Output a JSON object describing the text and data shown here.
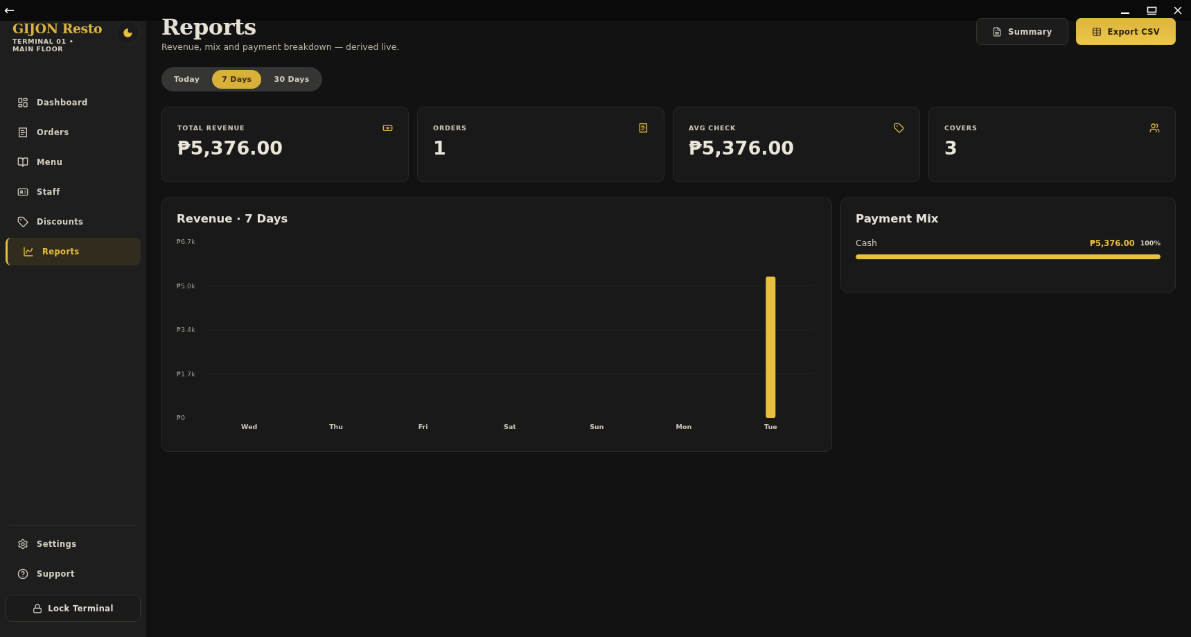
{
  "window": {
    "back": "←"
  },
  "sidebar": {
    "brand": "GIJON Resto",
    "terminal": "TERMINAL 01 • MAIN FLOOR",
    "items": [
      {
        "label": "Dashboard",
        "selected": false
      },
      {
        "label": "Orders",
        "selected": false
      },
      {
        "label": "Menu",
        "selected": false
      },
      {
        "label": "Staff",
        "selected": false
      },
      {
        "label": "Discounts",
        "selected": false
      },
      {
        "label": "Reports",
        "selected": true
      }
    ],
    "footer_items": [
      {
        "label": "Settings"
      },
      {
        "label": "Support"
      }
    ],
    "lock_button": "Lock Terminal"
  },
  "header": {
    "title": "Reports",
    "subtitle": "Revenue, mix and payment breakdown — derived live.",
    "buttons": [
      {
        "label": "Summary",
        "kind": "secondary"
      },
      {
        "label": "Export CSV",
        "kind": "primary"
      }
    ]
  },
  "range_tabs": [
    {
      "label": "Today",
      "selected": false
    },
    {
      "label": "7 Days",
      "selected": true
    },
    {
      "label": "30 Days",
      "selected": false
    }
  ],
  "stats": [
    {
      "label": "TOTAL REVENUE",
      "value": "₱5,376.00"
    },
    {
      "label": "ORDERS",
      "value": "1"
    },
    {
      "label": "AVG CHECK",
      "value": "₱5,376.00"
    },
    {
      "label": "COVERS",
      "value": "3"
    }
  ],
  "revenue_card": {
    "chart_data": {
      "type": "bar",
      "title": "Revenue · 7 Days",
      "categories": [
        "Wed",
        "Thu",
        "Fri",
        "Sat",
        "Sun",
        "Mon",
        "Tue"
      ],
      "series": [
        {
          "color": "#e8bf3e",
          "values": [
            0,
            0,
            0,
            0,
            0,
            0,
            5400
          ]
        }
      ],
      "ylim": [
        0,
        6720
      ],
      "yticks": [
        {
          "value": 0,
          "label": "₱0"
        },
        {
          "value": 1680,
          "label": "₱1.7k"
        },
        {
          "value": 3360,
          "label": "₱3.4k"
        },
        {
          "value": 5040,
          "label": "₱5.0k"
        },
        {
          "value": 6720,
          "label": "₱6.7k"
        }
      ]
    }
  },
  "payment_mix": {
    "title": "Payment Mix",
    "methods": [
      {
        "name": "Cash",
        "amount": "₱5,376.00",
        "share": "100%",
        "level": 1
      }
    ]
  }
}
